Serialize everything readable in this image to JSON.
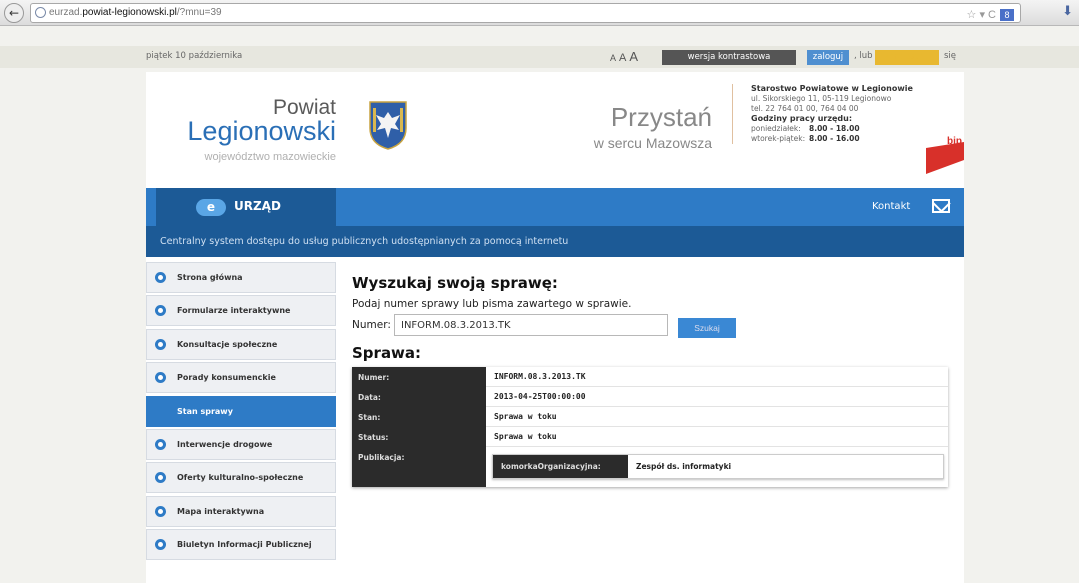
{
  "browser": {
    "url_prefix": "eurzad.",
    "url_domain": "powiat-legionowski.pl",
    "url_path": "/?mnu=39",
    "reload_glyph": "☆ ▾ C",
    "search_engine_glyph": "8",
    "nav_back_glyph": "←",
    "download_glyph": "⬇"
  },
  "util": {
    "date": "piątek 10 października",
    "font_sizes": [
      "A",
      "A",
      "A"
    ],
    "contrast_label": "wersja kontrastowa",
    "login_label": "zaloguj",
    "separator": ", lub",
    "register_label": "zarejestruj",
    "suffix": "się"
  },
  "header": {
    "powiat": "Powiat",
    "legionowski": "Legionowski",
    "wojewodztwo": "województwo mazowieckie",
    "przystan": "Przystań",
    "w_sercu": "w sercu Mazowsza",
    "contact": {
      "title": "Starostwo Powiatowe w Legionowie",
      "address": "ul. Sikorskiego 11, 05-119 Legionowo",
      "phone": "tel. 22 764 01 00, 764 04 00",
      "hours_title": "Godziny pracy urzędu:",
      "hours": [
        {
          "day": "poniedziałek:",
          "time": "8.00 - 18.00"
        },
        {
          "day": "wtorek-piątek:",
          "time": "8.00 - 16.00"
        }
      ]
    },
    "bip_label": "bip"
  },
  "nav": {
    "e_badge": "e",
    "urzad": "URZĄD",
    "kontakt": "Kontakt",
    "subtitle": "Centralny system dostępu do usług publicznych udostępnianych za pomocą internetu"
  },
  "sidebar": {
    "items": [
      {
        "label": "Strona główna",
        "active": false
      },
      {
        "label": "Formularze interaktywne",
        "active": false
      },
      {
        "label": "Konsultacje społeczne",
        "active": false
      },
      {
        "label": "Porady konsumenckie",
        "active": false
      },
      {
        "label": "Stan sprawy",
        "active": true
      },
      {
        "label": "Interwencje drogowe",
        "active": false
      },
      {
        "label": "Oferty kulturalno-społeczne",
        "active": false
      },
      {
        "label": "Mapa interaktywna",
        "active": false
      },
      {
        "label": "Biuletyn Informacji Publicznej",
        "active": false
      }
    ]
  },
  "search": {
    "title": "Wyszukaj swoją sprawę:",
    "description": "Podaj numer sprawy lub pisma zawartego w sprawie.",
    "numer_label": "Numer:",
    "numer_value": "INFORM.08.3.2013.TK",
    "button_label": "Szukaj"
  },
  "case": {
    "title": "Sprawa:",
    "rows": [
      {
        "key": "Numer:",
        "value": "INFORM.08.3.2013.TK"
      },
      {
        "key": "Data:",
        "value": "2013-04-25T00:00:00"
      },
      {
        "key": "Stan:",
        "value": "Sprawa w toku"
      },
      {
        "key": "Status:",
        "value": "Sprawa w toku"
      }
    ],
    "publication_key": "Publikacja:",
    "publication": {
      "key": "komorkaOrganizacyjna:",
      "value": "Zespół ds. informatyki"
    }
  }
}
